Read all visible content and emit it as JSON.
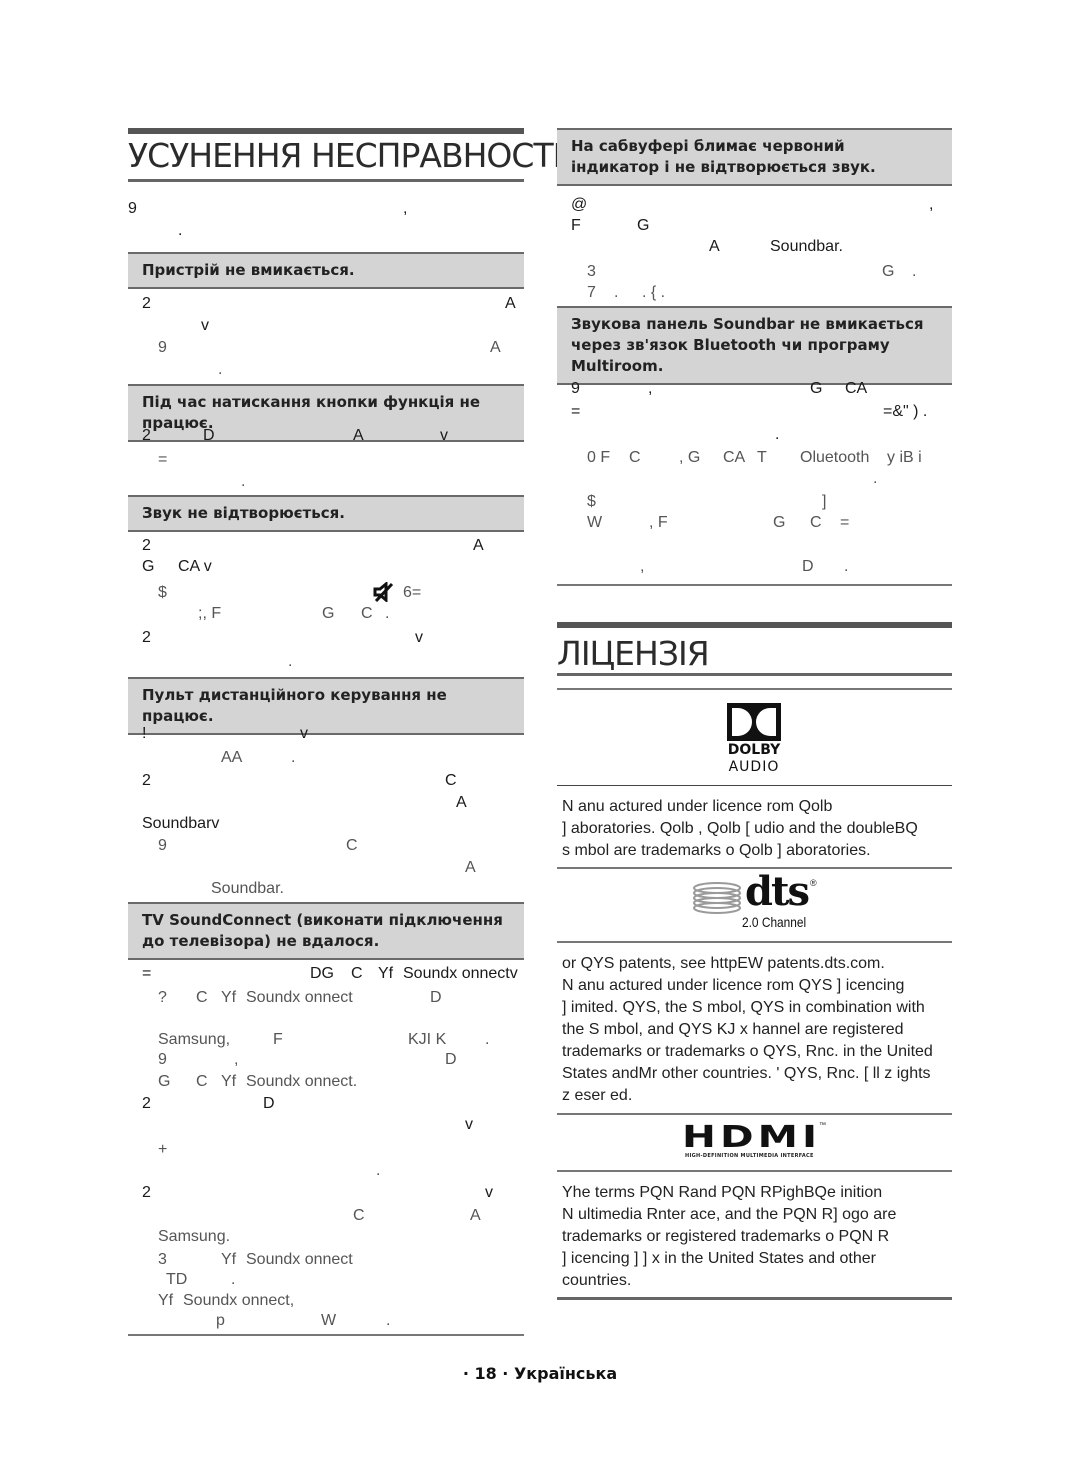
{
  "troubleshooting": {
    "title": "УСУНЕННЯ НЕСПРАВНОСТЕЙ",
    "intro": [
      {
        "t": [
          "9",
          ",",
          ""
        ]
      },
      {
        "t": [
          "."
        ]
      }
    ],
    "issues": [
      {
        "heading": "Пристрій не вмикається.",
        "lines": [
          {
            "sub": false,
            "glyphs": [
              "2",
              "A"
            ]
          },
          {
            "sub": false,
            "glyphs": [
              "v"
            ]
          },
          {
            "sub": true,
            "glyphs": [
              "9",
              "A"
            ]
          },
          {
            "sub": true,
            "glyphs": [
              "."
            ]
          }
        ]
      },
      {
        "heading": "Під час натискання кнопки функція не працює.",
        "lines": [
          {
            "sub": false,
            "glyphs": [
              "2",
              "D",
              "A",
              "v"
            ]
          },
          {
            "sub": true,
            "glyphs": [
              "="
            ]
          },
          {
            "sub": true,
            "glyphs": [
              "."
            ]
          }
        ]
      },
      {
        "heading": "Звук не відтворюється.",
        "lines": [
          {
            "sub": false,
            "glyphs": [
              "2",
              "A"
            ]
          },
          {
            "sub": false,
            "glyphs": [
              "G",
              "CA v"
            ]
          },
          {
            "sub": true,
            "glyphs": [
              "$",
              "6="
            ]
          },
          {
            "sub": true,
            "glyphs": [
              ";, F",
              "G",
              "C",
              "."
            ]
          },
          {
            "sub": false,
            "glyphs": [
              "2",
              "v"
            ]
          },
          {
            "sub": true,
            "glyphs": [
              "."
            ]
          }
        ]
      },
      {
        "heading": "Пульт дистанційного керування не працює.",
        "lines": [
          {
            "sub": false,
            "glyphs": [
              "!",
              "v"
            ]
          },
          {
            "sub": true,
            "glyphs": [
              "AA",
              "."
            ]
          },
          {
            "sub": false,
            "glyphs": [
              "2",
              "C"
            ]
          },
          {
            "sub": false,
            "glyphs": [
              "A"
            ]
          },
          {
            "sub": false,
            "glyphs": [
              "Soundbarv"
            ]
          },
          {
            "sub": true,
            "glyphs": [
              "9",
              "C"
            ]
          },
          {
            "sub": true,
            "glyphs": [
              "A"
            ]
          },
          {
            "sub": true,
            "glyphs": [
              "Soundbar."
            ]
          }
        ]
      },
      {
        "heading": "TV SoundConnect (виконати підключення до телевізора) не вдалося.",
        "lines": [
          {
            "sub": false,
            "glyphs": [
              "=",
              "DG",
              "C",
              "Yf",
              "Soundx onnectv"
            ]
          },
          {
            "sub": true,
            "glyphs": [
              "?",
              "C",
              "Yf",
              "Soundx onnect",
              "D"
            ]
          },
          {
            "sub": true,
            "glyphs": [
              ""
            ]
          },
          {
            "sub": true,
            "glyphs": [
              "Samsung,",
              "F",
              "KJI K",
              "."
            ]
          },
          {
            "sub": true,
            "glyphs": [
              "9",
              ",",
              "D"
            ]
          },
          {
            "sub": true,
            "glyphs": [
              "G",
              "C",
              "Yf",
              "Soundx onnect."
            ]
          },
          {
            "sub": false,
            "glyphs": [
              "2",
              "D"
            ]
          },
          {
            "sub": false,
            "glyphs": [
              "v"
            ]
          },
          {
            "sub": true,
            "glyphs": [
              "+"
            ]
          },
          {
            "sub": true,
            "glyphs": [
              "."
            ]
          },
          {
            "sub": false,
            "glyphs": [
              "2",
              "v"
            ]
          },
          {
            "sub": true,
            "glyphs": [
              "C",
              "A"
            ]
          },
          {
            "sub": true,
            "glyphs": [
              "Samsung."
            ]
          },
          {
            "sub": true,
            "glyphs": [
              "3",
              "Yf",
              "Soundx onnect"
            ]
          },
          {
            "sub": true,
            "glyphs": [
              "TD",
              "."
            ]
          },
          {
            "sub": true,
            "glyphs": [
              "Yf",
              "Soundx onnect,"
            ]
          },
          {
            "sub": true,
            "glyphs": [
              "p",
              "W",
              "."
            ]
          }
        ]
      },
      {
        "heading": "На сабвуфері блимає червоний індикатор і не відтворюється звук.",
        "lines": [
          {
            "sub": false,
            "glyphs": [
              "@",
              ","
            ]
          },
          {
            "sub": false,
            "glyphs": [
              "F",
              "G"
            ]
          },
          {
            "sub": false,
            "glyphs": [
              "A",
              "Soundbar."
            ]
          },
          {
            "sub": true,
            "glyphs": [
              "3",
              "G",
              "."
            ]
          },
          {
            "sub": true,
            "glyphs": [
              "7",
              ".",
              ". { ."
            ]
          }
        ]
      },
      {
        "heading": "Звукова панель Soundbar не вмикається через зв'язок Bluetooth чи програму Multiroom.",
        "lines": [
          {
            "sub": false,
            "glyphs": [
              "9",
              ",",
              "G",
              "CA"
            ]
          },
          {
            "sub": false,
            "glyphs": [
              "=",
              "=&\" ) ."
            ]
          },
          {
            "sub": false,
            "glyphs": [
              "."
            ]
          },
          {
            "sub": true,
            "glyphs": [
              "0 F",
              "C",
              ", G",
              "CA",
              "T",
              "Oluetooth",
              "y iB i"
            ]
          },
          {
            "sub": true,
            "glyphs": [
              "."
            ]
          },
          {
            "sub": true,
            "glyphs": [
              "$",
              "]"
            ]
          },
          {
            "sub": true,
            "glyphs": [
              "W",
              ", F",
              "G",
              "C",
              "="
            ]
          },
          {
            "sub": true,
            "glyphs": [
              ""
            ]
          },
          {
            "sub": true,
            "glyphs": [
              ",",
              "D",
              "."
            ]
          }
        ]
      }
    ]
  },
  "license": {
    "title": "ЛІЦЕНЗІЯ",
    "dolby": {
      "logo_word1": "DOLBY",
      "logo_word2": "AUDIO",
      "text": [
        "N anu actured under licence  rom Qolb",
        "] aboratories. Qolb , Qolb   [ udio and the doubleBQ",
        "s  mbol are trademarks o  Qolb   ] aboratories."
      ]
    },
    "dts": {
      "logo_word": "dts",
      "logo_reg": "®",
      "logo_sub": "2.0 Channel",
      "text": [
        "  or QYS patents, see httpEW patents.dts.com.",
        "N anu actured under licence  rom QYS ] icencing",
        "] imited. QYS, the S  mbol, QYS in combination with",
        "the S  mbol, and QYS KJ  x hannel are registered",
        "trademarks or trademarks o  QYS, Rnc. in the United",
        "States andMr other countries. '   QYS, Rnc. [ ll z ights",
        "z eser  ed."
      ]
    },
    "hdmi": {
      "logo_word": "HDMI",
      "logo_tm": "™",
      "logo_sub": "HIGH-DEFINITION MULTIMEDIA INTERFACE",
      "text": [
        "Yhe terms PQN Rand PQN RPighBQe inition",
        "N ultimedia Rnter ace, and the PQN R] ogo are",
        "trademarks or registered trademarks o  PQN R",
        "] icencing ] ] x  in the United States and other",
        "countries."
      ]
    }
  },
  "footer": {
    "page_label": "· 18 · Українська"
  }
}
